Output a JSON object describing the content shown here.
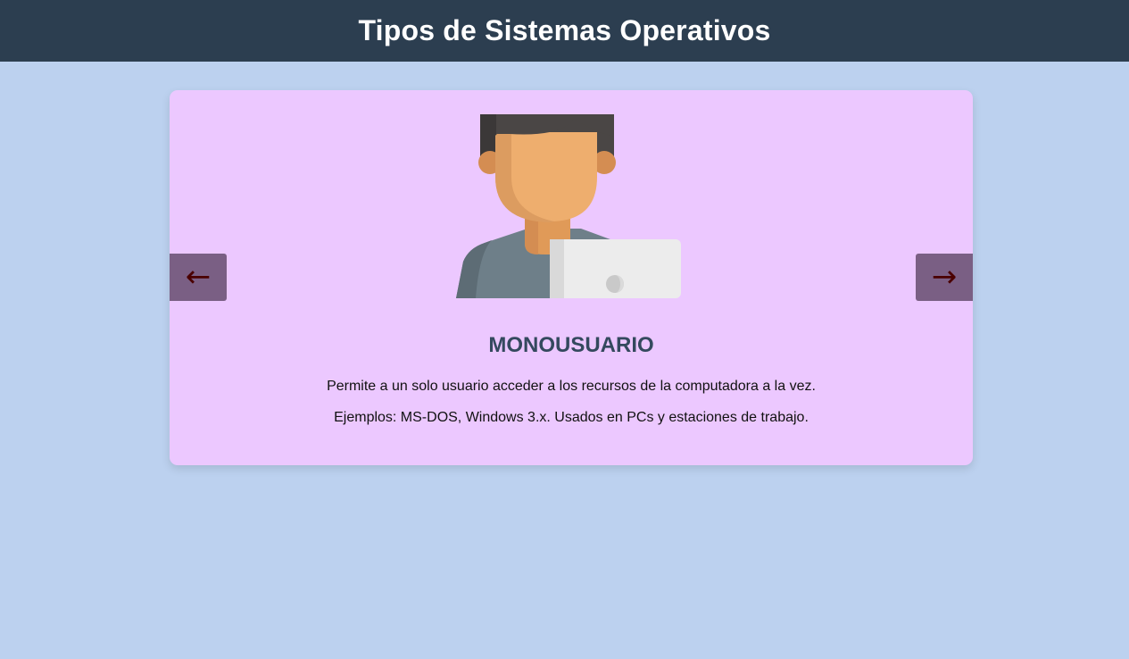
{
  "header": {
    "title": "Tipos de Sistemas Operativos"
  },
  "slide": {
    "icon": "user-with-laptop-icon",
    "title": "MONOUSUARIO",
    "description": "Permite a un solo usuario acceder a los recursos de la computadora a la vez.",
    "examples": "Ejemplos: MS-DOS, Windows 3.x. Usados en PCs y estaciones de trabajo."
  },
  "nav": {
    "prev_label": "←",
    "next_label": "→"
  },
  "colors": {
    "page_background": "#bcd1ef",
    "header_background": "#2c3e50",
    "card_background": "#ecc8ff",
    "title_color": "#34495e",
    "nav_button_background": "#7a5f84"
  }
}
